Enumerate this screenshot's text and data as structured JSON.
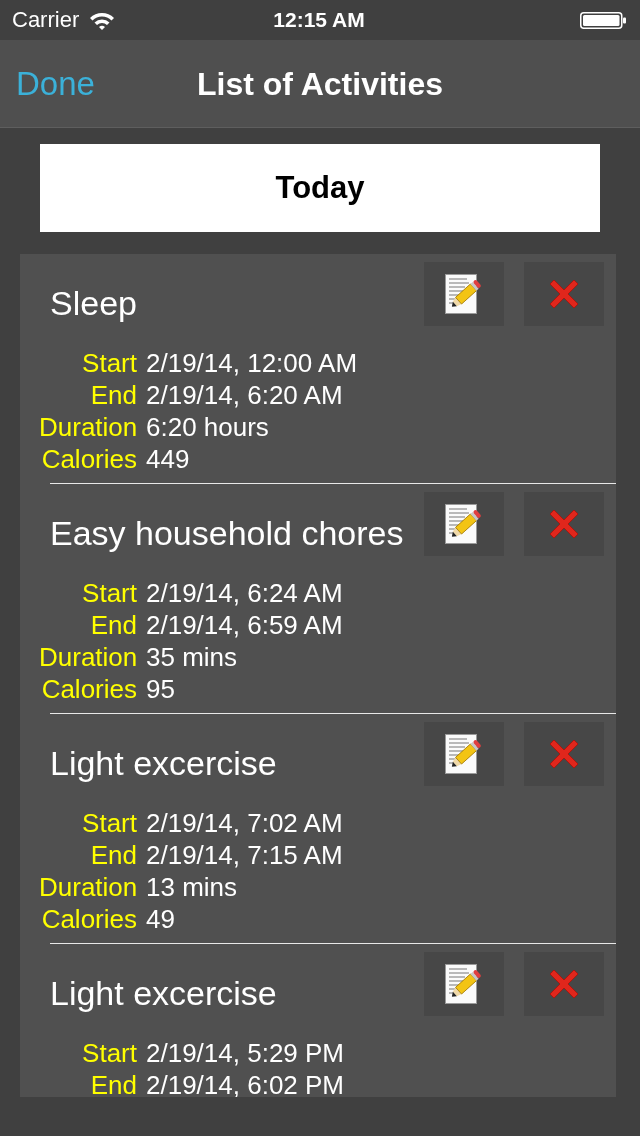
{
  "status_bar": {
    "carrier": "Carrier",
    "time": "12:15 AM"
  },
  "nav_bar": {
    "back_button": "Done",
    "title": "List of Activities"
  },
  "date_button": "Today",
  "activities": [
    {
      "title": "Sleep",
      "details": [
        {
          "label": "Start",
          "value": "2/19/14, 12:00 AM"
        },
        {
          "label": "End",
          "value": "2/19/14, 6:20 AM"
        },
        {
          "label": "Duration",
          "value": "6:20 hours"
        },
        {
          "label": "Calories",
          "value": "449"
        }
      ]
    },
    {
      "title": "Easy household chores",
      "details": [
        {
          "label": "Start",
          "value": "2/19/14, 6:24 AM"
        },
        {
          "label": "End",
          "value": "2/19/14, 6:59 AM"
        },
        {
          "label": "Duration",
          "value": "35 mins"
        },
        {
          "label": "Calories",
          "value": "95"
        }
      ]
    },
    {
      "title": "Light excercise",
      "details": [
        {
          "label": "Start",
          "value": "2/19/14, 7:02 AM"
        },
        {
          "label": "End",
          "value": "2/19/14, 7:15 AM"
        },
        {
          "label": "Duration",
          "value": "13 mins"
        },
        {
          "label": "Calories",
          "value": "49"
        }
      ]
    },
    {
      "title": "Light excercise",
      "details": [
        {
          "label": "Start",
          "value": "2/19/14, 5:29 PM"
        },
        {
          "label": "End",
          "value": "2/19/14, 6:02 PM"
        }
      ]
    }
  ]
}
